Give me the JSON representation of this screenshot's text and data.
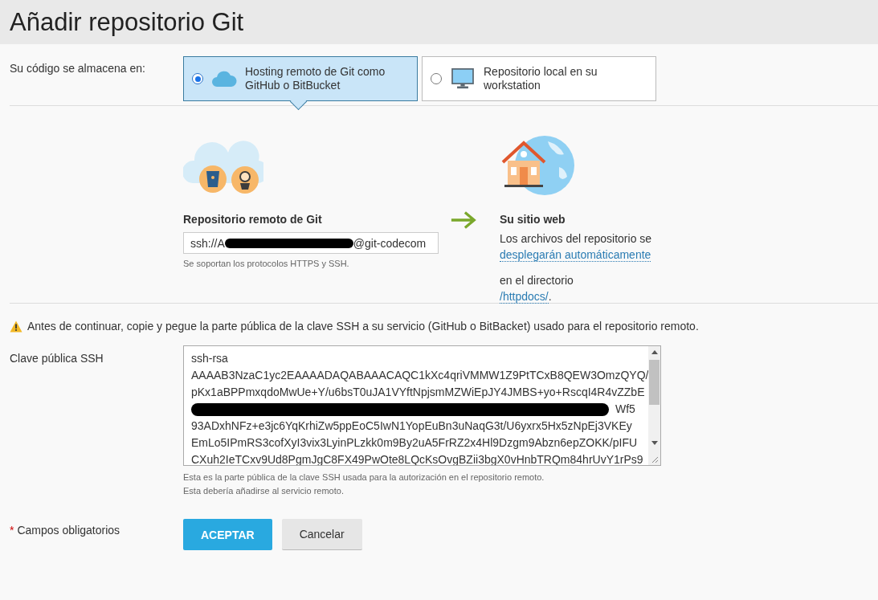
{
  "title": "Añadir repositorio Git",
  "storage": {
    "label": "Su código se almacena en:",
    "options": [
      {
        "kind": "cloud",
        "label": "Hosting remoto de Git como GitHub o BitBucket",
        "selected": true
      },
      {
        "kind": "monitor",
        "label": "Repositorio local en su workstation",
        "selected": false
      }
    ]
  },
  "remote": {
    "heading": "Repositorio remoto de Git",
    "value_start": "ssh://A",
    "value_end": "@git-codecom",
    "hint": "Se soportan los protocolos HTTPS y SSH."
  },
  "site": {
    "heading": "Su sitio web",
    "text_1": "Los archivos del repositorio se",
    "link_1": "desplegarán automáticamente",
    "text_2": "en el directorio",
    "link_2": "/httpdocs/",
    "text_3": "."
  },
  "warning": "Antes de continuar, copie y pegue la parte pública de la clave SSH a su servicio (GitHub o BitBacket) usado para el repositorio remoto.",
  "ssh_key": {
    "label": "Clave pública SSH",
    "lines": [
      {
        "kind": "text",
        "text": "ssh-rsa"
      },
      {
        "kind": "text",
        "text": "AAAAB3NzaC1yc2EAAAADAQABAAACAQC1kXc4qriVMMW1Z9PtTCxB8QEW3OmzQYQ/"
      },
      {
        "kind": "text",
        "text": "pKx1aBPPmxqdoMwUe+Y/u6bsT0uJA1VYftNpjsmMZWiEpJY4JMBS+yo+RscqI4R4vZZbE"
      },
      {
        "kind": "redacted",
        "text": "Wf5"
      },
      {
        "kind": "text",
        "text": "93ADxhNFz+e3jc6YqKrhiZw5ppEoC5IwN1YopEuBn3uNaqG3t/U6yxrx5Hx5zNpEj3VKEy"
      },
      {
        "kind": "text",
        "text": "EmLo5IPmRS3cofXyI3vix3LyinPLzkk0m9By2uA5FrRZ2x4Hl9Dzgm9Abzn6epZOKK/pIFU"
      },
      {
        "kind": "text",
        "text": "CXuh2IeTCxv9Ud8PgmJgC8FX49PwOte8LQcKsOvgBZii3bgX0vHnbTRQm84hrUvY1rPs9"
      }
    ],
    "hint": "Esta es la parte pública de la clave SSH usada para la autorización en el repositorio remoto. Esta debería añadirse al servicio remoto."
  },
  "footer": {
    "required_mark": "*",
    "required_label": "Campos obligatorios",
    "buttons": [
      {
        "kind": "primary",
        "label": "ACEPTAR"
      },
      {
        "kind": "secondary",
        "label": "Cancelar"
      }
    ]
  }
}
